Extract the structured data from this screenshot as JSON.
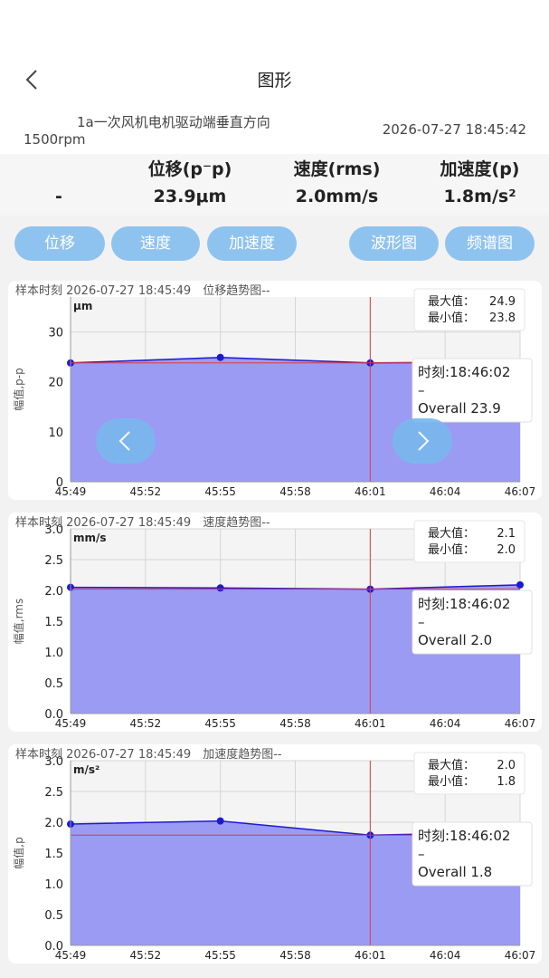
{
  "header": {
    "title": "图形"
  },
  "device": {
    "name": "1a一次风机电机驱动端垂直方向",
    "speed": "1500rpm",
    "timestamp": "2026-07-27 18:45:42"
  },
  "summary": {
    "headers": [
      "位移(p⁻p)",
      "速度(rms)",
      "加速度(p)"
    ],
    "blank": "-",
    "values": [
      "23.9μm",
      "2.0mm/s",
      "1.8m/s²"
    ]
  },
  "buttons": {
    "displacement": "位移",
    "velocity": "速度",
    "acceleration": "加速度",
    "waveform": "波形图",
    "spectrum": "频谱图"
  },
  "colors": {
    "accent": "#8fc3ef",
    "fill": "#9b9bf3",
    "line": "#1a1ad6",
    "cursor": "#e23b3b"
  },
  "icons": {
    "back": "chevron-left-icon",
    "prev": "chevron-left-icon",
    "next": "chevron-right-icon"
  },
  "chart_data": [
    {
      "type": "area",
      "title": "样本时刻 2026-07-27 18:45:49　位移趋势图--",
      "ylabel": "幅值,p-p",
      "unit": "μm",
      "xticks": [
        "45:49",
        "45:52",
        "45:55",
        "45:58",
        "46:01",
        "46:04",
        "46:07"
      ],
      "x": [
        0,
        6,
        12,
        18
      ],
      "y": [
        23.8,
        24.9,
        23.8,
        24.0
      ],
      "ylim": [
        0,
        37
      ],
      "yticks": [
        0,
        10,
        20,
        30
      ],
      "ytick_labels": [
        "0",
        "10",
        "20",
        "30"
      ],
      "cursor_x": 12,
      "max_label": "最大值：",
      "max_value": "24.9",
      "min_label": "最小值：",
      "min_value": "23.8",
      "tooltip_time": "时刻:18:46:02",
      "tooltip_dash": "–",
      "tooltip_overall": "Overall 23.9",
      "show_nav": true
    },
    {
      "type": "area",
      "title": "样本时刻 2026-07-27 18:45:49　速度趋势图--",
      "ylabel": "幅值,rms",
      "unit": "mm/s",
      "xticks": [
        "45:49",
        "45:52",
        "45:55",
        "45:58",
        "46:01",
        "46:04",
        "46:07"
      ],
      "x": [
        0,
        6,
        12,
        18
      ],
      "y": [
        2.05,
        2.04,
        2.02,
        2.09
      ],
      "ylim": [
        0,
        3.0
      ],
      "yticks": [
        0,
        0.5,
        1.0,
        1.5,
        2.0,
        2.5,
        3.0
      ],
      "ytick_labels": [
        "0.0",
        "0.5",
        "1.0",
        "1.5",
        "2.0",
        "2.5",
        "3.0"
      ],
      "cursor_x": 12,
      "max_label": "最大值：",
      "max_value": "2.1",
      "min_label": "最小值：",
      "min_value": "2.0",
      "tooltip_time": "时刻:18:46:02",
      "tooltip_dash": "–",
      "tooltip_overall": "Overall 2.0",
      "show_nav": false
    },
    {
      "type": "area",
      "title": "样本时刻 2026-07-27 18:45:49　加速度趋势图--",
      "ylabel": "幅值,p",
      "unit": "m/s²",
      "xticks": [
        "45:49",
        "45:52",
        "45:55",
        "45:58",
        "46:01",
        "46:04",
        "46:07"
      ],
      "x": [
        0,
        6,
        12,
        18
      ],
      "y": [
        1.97,
        2.02,
        1.79,
        1.84
      ],
      "ylim": [
        0,
        3.0
      ],
      "yticks": [
        0,
        0.5,
        1.0,
        1.5,
        2.0,
        2.5,
        3.0
      ],
      "ytick_labels": [
        "0.0",
        "0.5",
        "1.0",
        "1.5",
        "2.0",
        "2.5",
        "3.0"
      ],
      "cursor_x": 12,
      "max_label": "最大值：",
      "max_value": "2.0",
      "min_label": "最小值：",
      "min_value": "1.8",
      "tooltip_time": "时刻:18:46:02",
      "tooltip_dash": "–",
      "tooltip_overall": "Overall 1.8",
      "show_nav": false
    }
  ]
}
